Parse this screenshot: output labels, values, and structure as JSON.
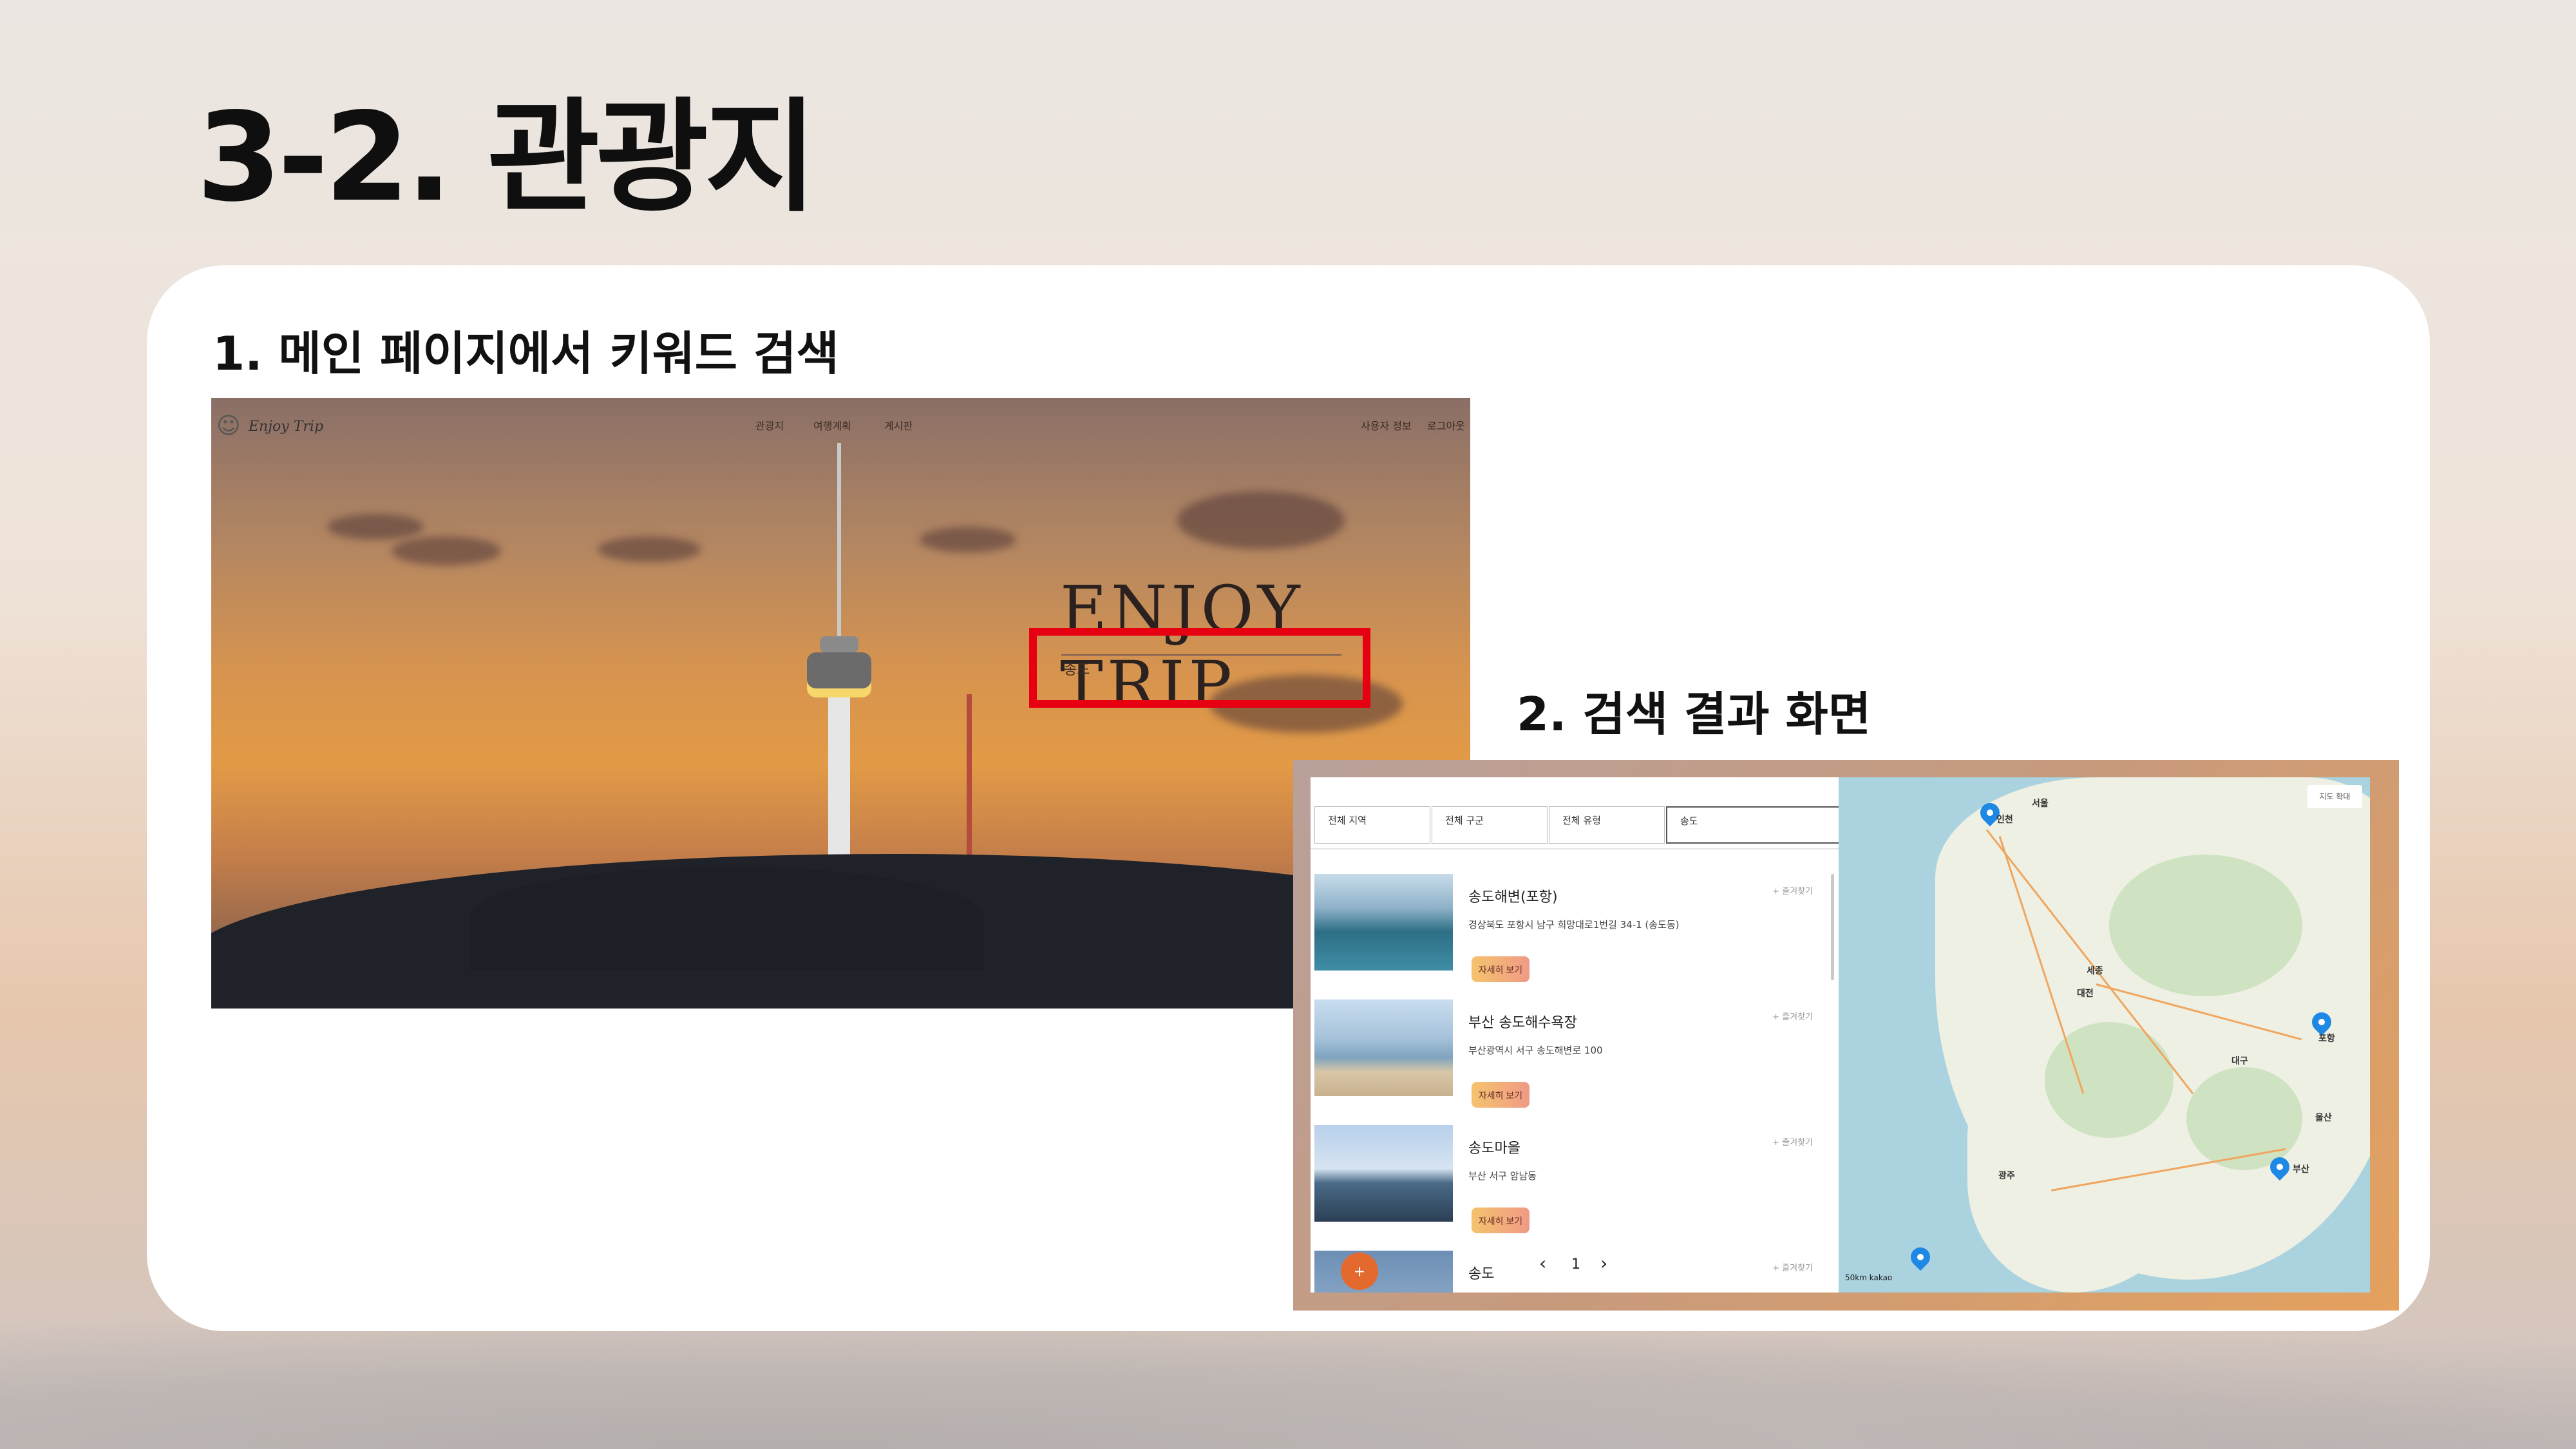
{
  "slide": {
    "title": "3-2. 관광지",
    "step1_label": "1. 메인 페이지에서 키워드 검색",
    "step2_label": "2. 검색 결과 화면"
  },
  "main_page": {
    "logo": "Enjoy Trip",
    "nav": [
      "관광지",
      "여행계획",
      "게시판"
    ],
    "user_menu": [
      "사용자 정보",
      "로그아웃"
    ],
    "hero": "ENJOY TRIP",
    "search_value": "송도",
    "colors": {
      "highlight": "#e60012"
    }
  },
  "results_page": {
    "filters": [
      "전체 지역",
      "전체 구군",
      "전체 유형"
    ],
    "search_value": "송도",
    "items": [
      {
        "name": "송도해변(포항)",
        "address": "경상북도 포항시 남구 희망대로1번길 34-1 (송도동)",
        "button": "자세히 보기",
        "fav": "+ 즐겨찾기"
      },
      {
        "name": "부산 송도해수욕장",
        "address": "부산광역시 서구 송도해변로 100",
        "button": "자세히 보기",
        "fav": "+ 즐겨찾기"
      },
      {
        "name": "송도마을",
        "address": "부산 서구 암남동",
        "button": "자세히 보기",
        "fav": "+ 즐겨찾기"
      },
      {
        "name": "송도",
        "address": "",
        "button": "",
        "fav": "+ 즐겨찾기"
      }
    ],
    "pager": {
      "prev": "‹",
      "page": "1",
      "next": "›"
    },
    "fab": "+",
    "map": {
      "zoom_control": "지도 확대",
      "scale": "50km",
      "attribution": "kakao",
      "cities": [
        "서울",
        "인천",
        "대전",
        "대구",
        "광주",
        "부산",
        "울산",
        "포항",
        "세종"
      ]
    }
  }
}
